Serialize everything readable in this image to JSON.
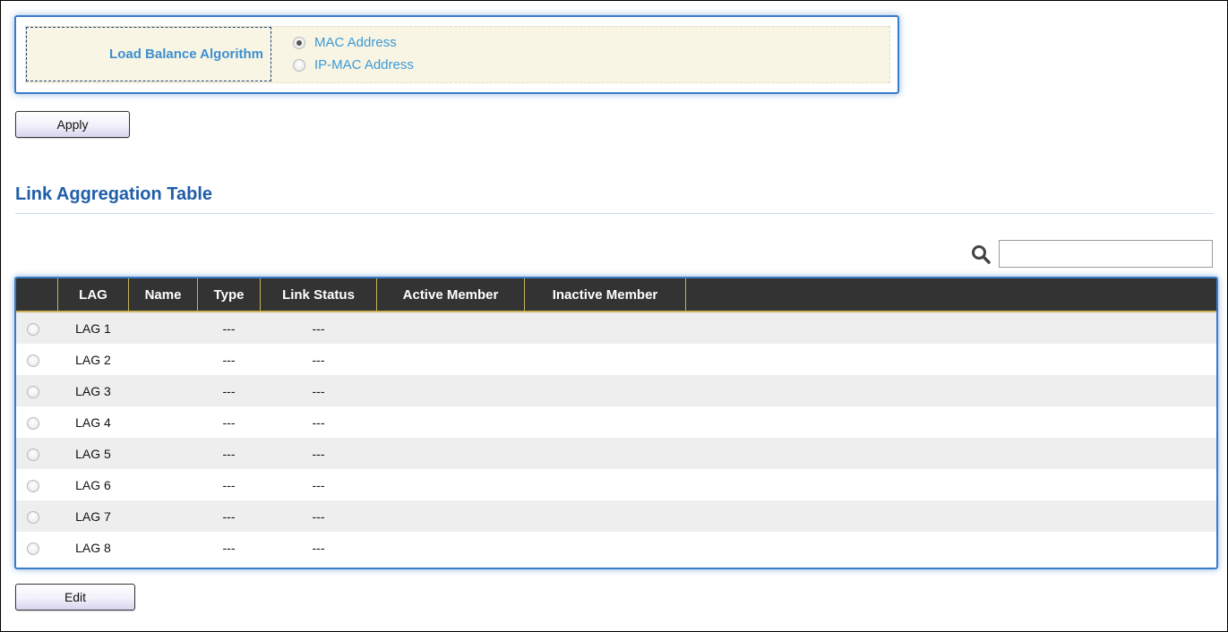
{
  "load_balance": {
    "label": "Load Balance Algorithm",
    "options": [
      {
        "label": "MAC Address",
        "selected": true
      },
      {
        "label": "IP-MAC Address",
        "selected": false
      }
    ]
  },
  "apply_button": "Apply",
  "section_title": "Link Aggregation Table",
  "search": {
    "placeholder": "",
    "value": "",
    "icon": "search-icon"
  },
  "table": {
    "headers": [
      "LAG",
      "Name",
      "Type",
      "Link Status",
      "Active Member",
      "Inactive Member"
    ],
    "rows": [
      {
        "lag": "LAG 1",
        "name": "",
        "type": "---",
        "link_status": "---",
        "active": "",
        "inactive": ""
      },
      {
        "lag": "LAG 2",
        "name": "",
        "type": "---",
        "link_status": "---",
        "active": "",
        "inactive": ""
      },
      {
        "lag": "LAG 3",
        "name": "",
        "type": "---",
        "link_status": "---",
        "active": "",
        "inactive": ""
      },
      {
        "lag": "LAG 4",
        "name": "",
        "type": "---",
        "link_status": "---",
        "active": "",
        "inactive": ""
      },
      {
        "lag": "LAG 5",
        "name": "",
        "type": "---",
        "link_status": "---",
        "active": "",
        "inactive": ""
      },
      {
        "lag": "LAG 6",
        "name": "",
        "type": "---",
        "link_status": "---",
        "active": "",
        "inactive": ""
      },
      {
        "lag": "LAG 7",
        "name": "",
        "type": "---",
        "link_status": "---",
        "active": "",
        "inactive": ""
      },
      {
        "lag": "LAG 8",
        "name": "",
        "type": "---",
        "link_status": "---",
        "active": "",
        "inactive": ""
      }
    ]
  },
  "edit_button": "Edit",
  "colors": {
    "accent": "#3a7cc8",
    "title": "#1f5ea8",
    "label": "#3d8fd0",
    "header_bg": "#333333",
    "header_border": "#c8b25a",
    "panel_bg": "#f8f5e4"
  }
}
